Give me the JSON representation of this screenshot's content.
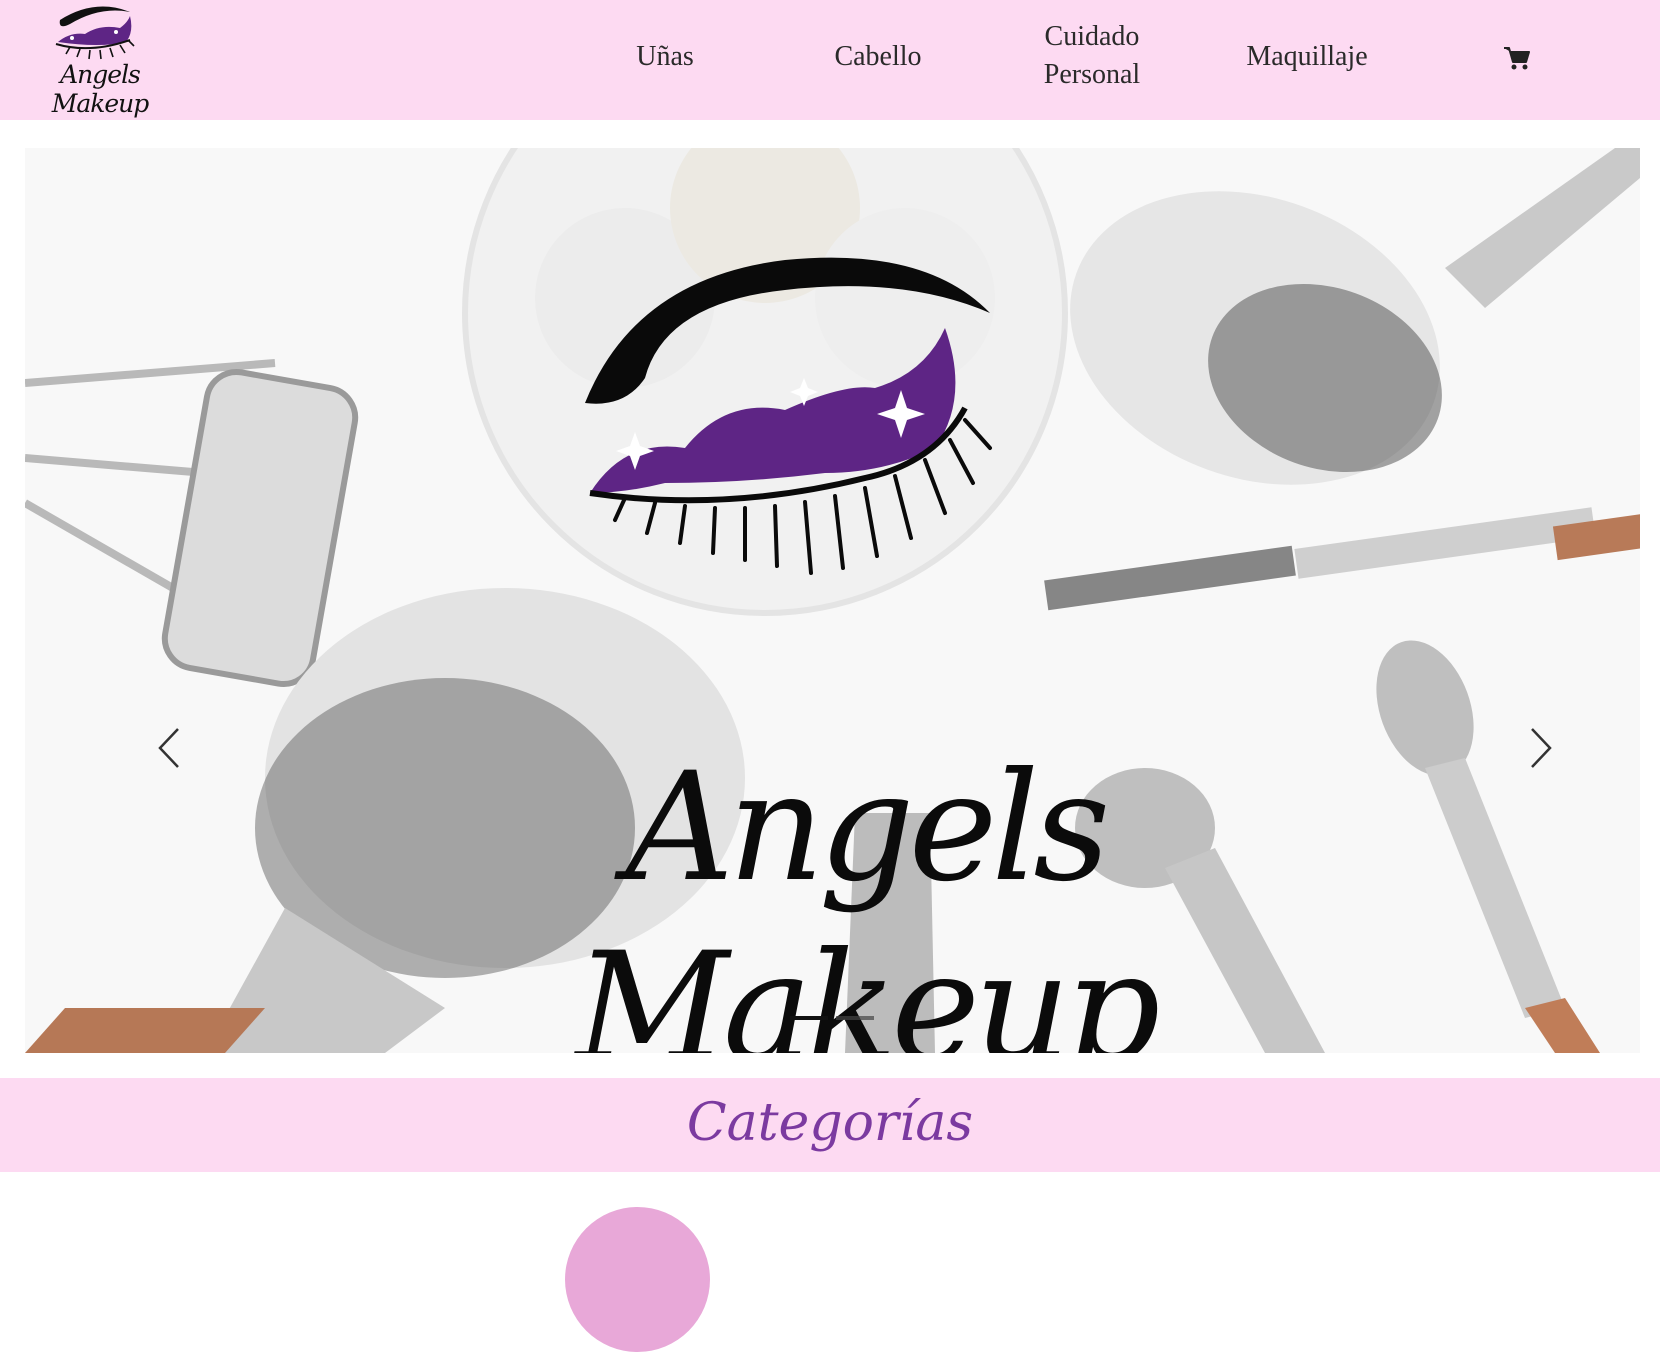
{
  "header": {
    "logo_text": "Angels Makeup",
    "nav": [
      {
        "label": "Uñas"
      },
      {
        "label": "Cabello"
      },
      {
        "label": "Cuidado Personal"
      },
      {
        "label": "Maquillaje"
      }
    ],
    "cart_icon": "shopping-cart-icon"
  },
  "hero": {
    "brand_text": "Angels Makeup",
    "prev_icon": "chevron-left-icon",
    "next_icon": "chevron-right-icon",
    "slides_count": 2,
    "active_slide": 1
  },
  "categories": {
    "title": "Categorías"
  },
  "colors": {
    "header_bg": "#fddaf2",
    "accent_purple": "#5e2585",
    "title_purple": "#7b3aa0",
    "text_dark": "#2a2a2a"
  }
}
